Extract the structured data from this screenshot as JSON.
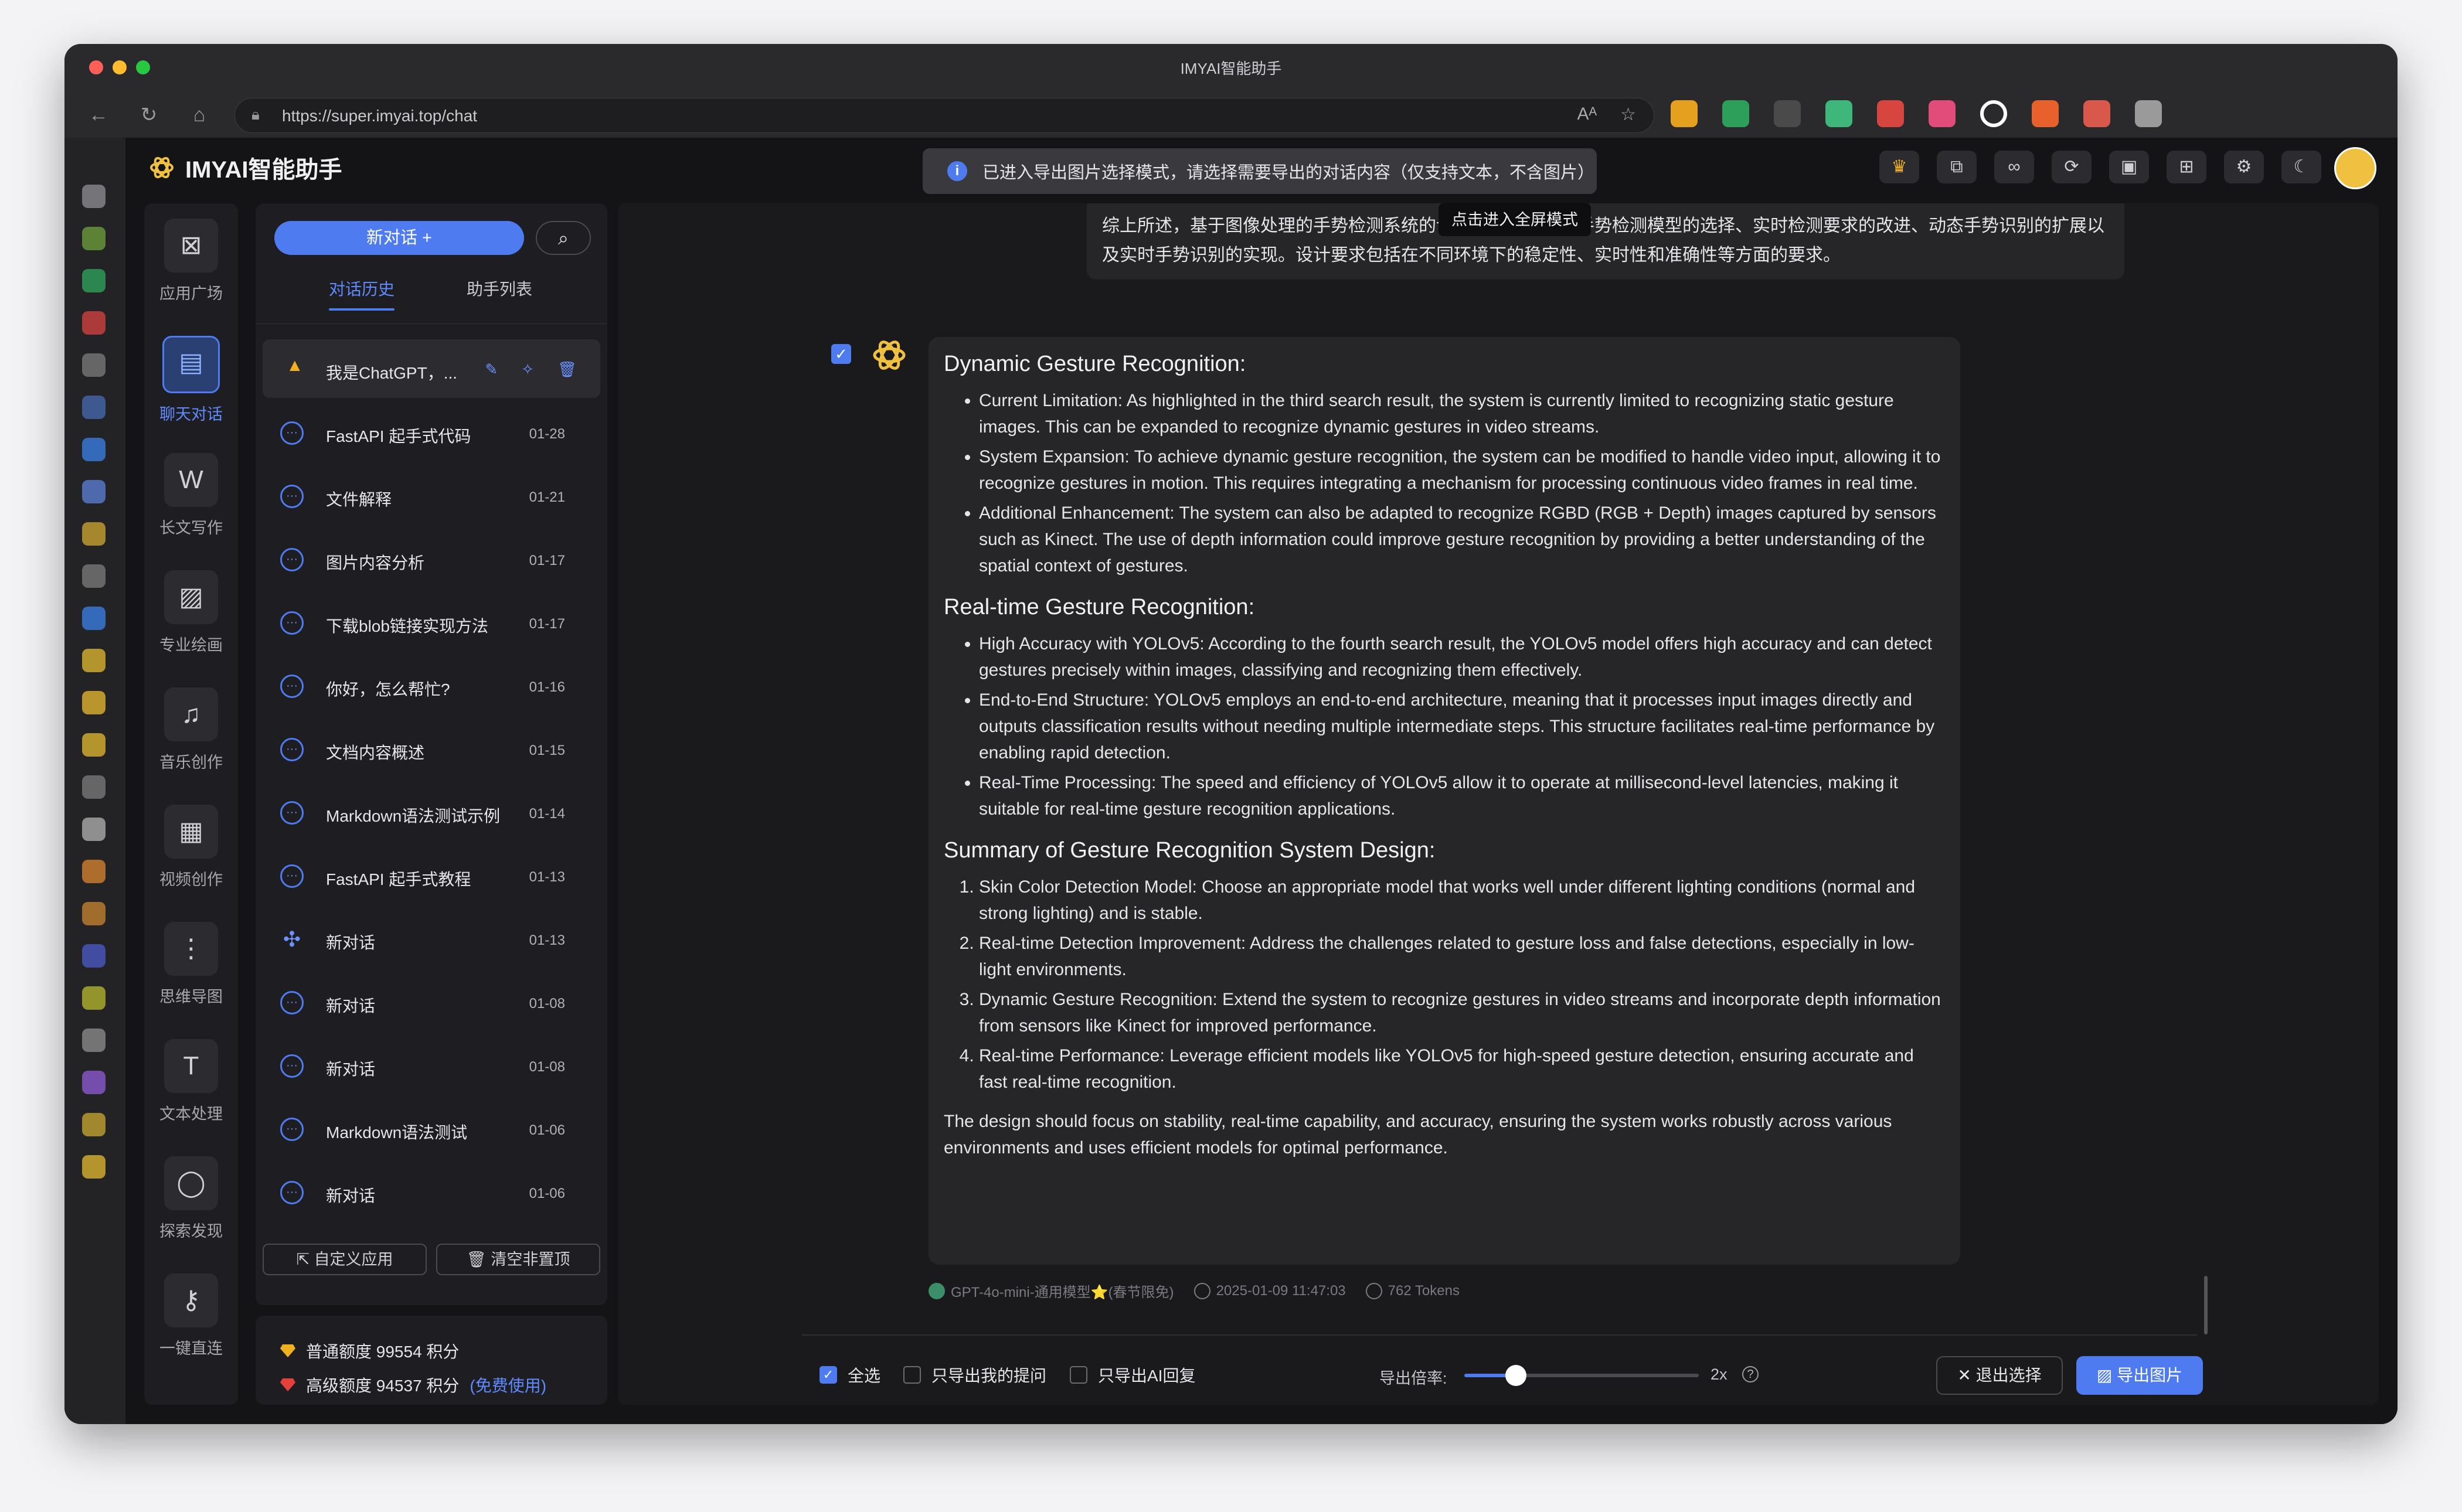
{
  "window": {
    "title": "IMYAI智能助手"
  },
  "browser": {
    "url": "https://super.imyai.top/chat",
    "extension_colors": [
      "#e5a020",
      "#2e9f5a",
      "#4a4a4a",
      "#3fb67a",
      "#d6453f",
      "#e24c7a",
      "#ffffff",
      "#e8602c",
      "#d8584c",
      "#9a9a9a"
    ]
  },
  "app": {
    "brand": "IMYAI智能助手",
    "toast": {
      "icon": "info-icon",
      "text": "已进入导出图片选择模式，请选择需要导出的对话内容（仅支持文本，不含图片）"
    },
    "header_buttons": [
      "crown-icon",
      "translate-icon",
      "link-icon",
      "sync-icon",
      "clipboard-icon",
      "gift-icon",
      "gear-icon",
      "moon-icon"
    ]
  },
  "rail": {
    "items": [
      {
        "label": "应用广场",
        "icon": "apps-icon"
      },
      {
        "label": "聊天对话",
        "icon": "chat-icon",
        "active": true
      },
      {
        "label": "长文写作",
        "icon": "word-icon"
      },
      {
        "label": "专业绘画",
        "icon": "image-icon"
      },
      {
        "label": "音乐创作",
        "icon": "music-icon"
      },
      {
        "label": "视频创作",
        "icon": "video-icon"
      },
      {
        "label": "思维导图",
        "icon": "mindmap-icon"
      },
      {
        "label": "文本处理",
        "icon": "text-icon"
      },
      {
        "label": "探索发现",
        "icon": "planet-icon"
      },
      {
        "label": "一键直连",
        "icon": "key-icon"
      }
    ]
  },
  "history": {
    "new_chat": "新对话 +",
    "tabs": [
      "对话历史",
      "助手列表"
    ],
    "pinned": {
      "title": "我是ChatGPT，...",
      "badge": "TOP"
    },
    "items": [
      {
        "title": "FastAPI 起手式代码",
        "date": "01-28"
      },
      {
        "title": "文件解释",
        "date": "01-21"
      },
      {
        "title": "图片内容分析",
        "date": "01-17"
      },
      {
        "title": "下载blob链接实现方法",
        "date": "01-17"
      },
      {
        "title": "你好，怎么帮忙?",
        "date": "01-16"
      },
      {
        "title": "文档内容概述",
        "date": "01-15"
      },
      {
        "title": "Markdown语法测试示例",
        "date": "01-14"
      },
      {
        "title": "FastAPI 起手式教程",
        "date": "01-13"
      },
      {
        "title": "新对话",
        "date": "01-13"
      },
      {
        "title": "新对话",
        "date": "01-08"
      },
      {
        "title": "新对话",
        "date": "01-08"
      },
      {
        "title": "Markdown语法测试",
        "date": "01-06"
      },
      {
        "title": "新对话",
        "date": "01-06"
      }
    ],
    "footer": {
      "custom_app": "自定义应用",
      "clear": "清空非置顶"
    }
  },
  "quota": {
    "normal": "普通额度 99554 积分",
    "premium": "高级额度 94537 积分",
    "premium_link": "(免费使用)"
  },
  "chat": {
    "previous_message": "综上所述，基于图像处理的手势检测系统的设计要求主要包括手势检测模型的选择、实时检测要求的改进、动态手势识别的扩展以及实时手势识别的实现。设计要求包括在不同环境下的稳定性、实时性和准确性等方面的要求。",
    "tooltip": "点击进入全屏模式",
    "sections": [
      {
        "heading": "Dynamic Gesture Recognition:",
        "ordered": false,
        "items": [
          {
            "term": "Current Limitation",
            "text": ": As highlighted in the third search result, the system is currently limited to recognizing static gesture images. This can be expanded to recognize dynamic gestures in video streams."
          },
          {
            "term": "System Expansion",
            "text": ": To achieve dynamic gesture recognition, the system can be modified to handle video input, allowing it to recognize gestures in motion. This requires integrating a mechanism for processing continuous video frames in real time."
          },
          {
            "term": "Additional Enhancement",
            "text": ": The system can also be adapted to recognize RGBD (RGB + Depth) images captured by sensors such as Kinect. The use of depth information could improve gesture recognition by providing a better understanding of the spatial context of gestures."
          }
        ]
      },
      {
        "heading": "Real-time Gesture Recognition:",
        "ordered": false,
        "items": [
          {
            "term": "High Accuracy with YOLOv5",
            "text": ": According to the fourth search result, the YOLOv5 model offers high accuracy and can detect gestures precisely within images, classifying and recognizing them effectively."
          },
          {
            "term": "End-to-End Structure",
            "text": ": YOLOv5 employs an end-to-end architecture, meaning that it processes input images directly and outputs classification results without needing multiple intermediate steps. This structure facilitates real-time performance by enabling rapid detection."
          },
          {
            "term": "Real-Time Processing",
            "text": ": The speed and efficiency of YOLOv5 allow it to operate at millisecond-level latencies, making it suitable for real-time gesture recognition applications."
          }
        ]
      },
      {
        "heading": "Summary of Gesture Recognition System Design:",
        "ordered": true,
        "items": [
          {
            "term": "Skin Color Detection Model",
            "text": ": Choose an appropriate model that works well under different lighting conditions (normal and strong lighting) and is stable."
          },
          {
            "term": "Real-time Detection Improvement",
            "text": ": Address the challenges related to gesture loss and false detections, especially in low-light environments."
          },
          {
            "term": "Dynamic Gesture Recognition",
            "text": ": Extend the system to recognize gestures in video streams and incorporate depth information from sensors like Kinect for improved performance."
          },
          {
            "term": "Real-time Performance",
            "text": ": Leverage efficient models like YOLOv5 for high-speed gesture detection, ensuring accurate and fast real-time recognition."
          }
        ]
      }
    ],
    "conclusion": "The design should focus on stability, real-time capability, and accuracy, ensuring the system works robustly across various environments and uses efficient models for optimal performance.",
    "meta": {
      "model": "GPT-4o-mini-通用模型⭐(春节限免)",
      "time": "2025-01-09 11:47:03",
      "tokens": "762 Tokens"
    }
  },
  "export": {
    "select_all": "全选",
    "only_questions": "只导出我的提问",
    "only_ai": "只导出AI回复",
    "ratio_label": "导出倍率:",
    "ratio_value": "2x",
    "ratio_fraction": 0.22,
    "exit": "退出选择",
    "export": "导出图片"
  }
}
